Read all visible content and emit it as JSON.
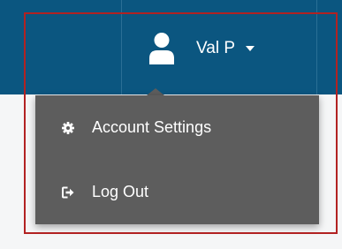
{
  "header": {
    "user_name": "Val P",
    "user_icon": "user-icon",
    "caret_icon": "caret-down-icon"
  },
  "user_menu": {
    "items": [
      {
        "label": "Account Settings",
        "icon": "gear-icon"
      },
      {
        "label": "Log Out",
        "icon": "sign-out-icon"
      }
    ]
  },
  "colors": {
    "topbar": "#0b5680",
    "dropdown": "#5d5d5d",
    "text": "#ffffff",
    "highlight": "#b22222"
  }
}
